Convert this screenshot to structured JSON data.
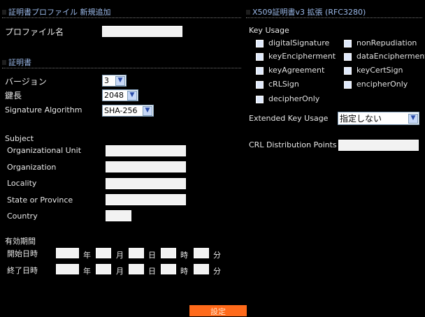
{
  "left_section": {
    "title": "証明書プロファイル 新規追加",
    "profile_name_label": "プロファイル名",
    "profile_name_value": ""
  },
  "cert_section": {
    "title": "証明書",
    "version_label": "バージョン",
    "version_value": "3",
    "key_length_label": "鍵長",
    "key_length_value": "2048",
    "sig_alg_label": "Signature Algorithm",
    "sig_alg_value": "SHA-256"
  },
  "subject": {
    "heading": "Subject",
    "ou_label": "Organizational Unit",
    "org_label": "Organization",
    "locality_label": "Locality",
    "state_label": "State or Province",
    "country_label": "Country"
  },
  "validity": {
    "heading": "有効期間",
    "start_label": "開始日時",
    "end_label": "終了日時",
    "year": "年",
    "month": "月",
    "day": "日",
    "hour": "時",
    "minute": "分"
  },
  "right_section": {
    "title": "X509証明書v3 拡張 (RFC3280)",
    "key_usage_heading": "Key Usage",
    "key_usage_items": [
      "digitalSignature",
      "nonRepudiation",
      "keyEncipherment",
      "dataEncipherment",
      "keyAgreement",
      "keyCertSign",
      "cRLSign",
      "encipherOnly",
      "decipherOnly"
    ],
    "eku_label": "Extended Key Usage",
    "eku_value": "指定しない",
    "crl_label": "CRL Distribution Points",
    "crl_value": ""
  },
  "submit_label": "設定"
}
